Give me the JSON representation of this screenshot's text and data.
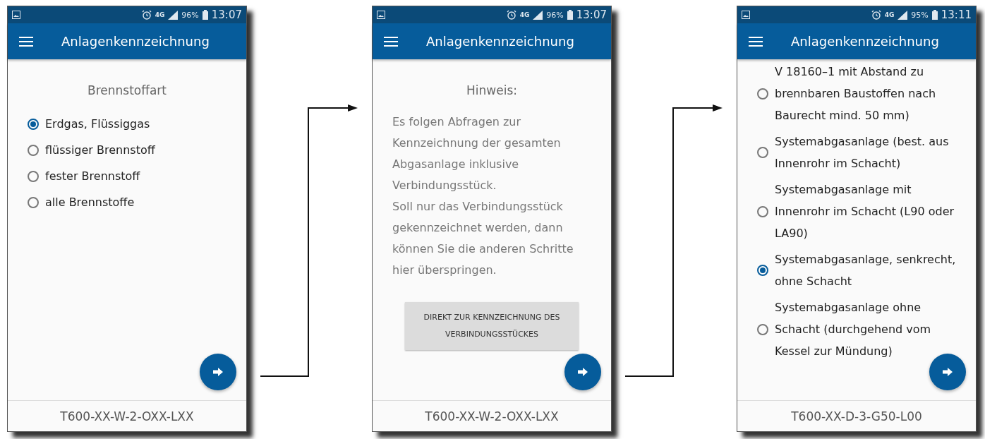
{
  "screens": [
    {
      "status_bar": {
        "network": "4G",
        "battery": "96%",
        "time": "13:07"
      },
      "app_bar": {
        "title": "Anlagenkennzeichnung"
      },
      "kind": "radio_list",
      "heading": "Brennstoffart",
      "options": [
        {
          "label": "Erdgas, Flüssiggas",
          "selected": true
        },
        {
          "label": "flüssiger Brennstoff",
          "selected": false
        },
        {
          "label": "fester Brennstoff",
          "selected": false
        },
        {
          "label": "alle Brennstoffe",
          "selected": false
        }
      ],
      "footer": "T600-XX-W-2-OXX-LXX"
    },
    {
      "status_bar": {
        "network": "4G",
        "battery": "96%",
        "time": "13:07"
      },
      "app_bar": {
        "title": "Anlagenkennzeichnung"
      },
      "kind": "notice",
      "heading": "Hinweis:",
      "paragraphs": [
        "Es folgen Abfragen zur Kennzeichnung der gesamten Abgasanlage inklusive Verbindungsstück.",
        "Soll nur das Verbindungsstück gekennzeichnet werden, dann können Sie die anderen Schritte hier überspringen."
      ],
      "button": "DIREKT ZUR KENNZEICHNUNG DES VERBINDUNGSSTÜCKES",
      "footer": "T600-XX-W-2-OXX-LXX"
    },
    {
      "status_bar": {
        "network": "4G",
        "battery": "95%",
        "time": "13:11"
      },
      "app_bar": {
        "title": "Anlagenkennzeichnung"
      },
      "kind": "radio_list",
      "options": [
        {
          "label": "V 18160–1 mit Abstand zu brennbaren Baustoffen nach Baurecht mind. 50 mm)",
          "selected": false
        },
        {
          "label": "Systemabgasanlage (best. aus Innenrohr im Schacht)",
          "selected": false
        },
        {
          "label": "Systemabgasanlage mit Innenrohr im Schacht (L90 oder LA90)",
          "selected": false
        },
        {
          "label": "Systemabgasanlage, senkrecht, ohne Schacht",
          "selected": true
        },
        {
          "label": "Systemabgasanlage ohne Schacht (durchgehend vom Kessel zur Mündung)",
          "selected": false
        }
      ],
      "footer": "T600-XX-D-3-G50-L00"
    }
  ]
}
